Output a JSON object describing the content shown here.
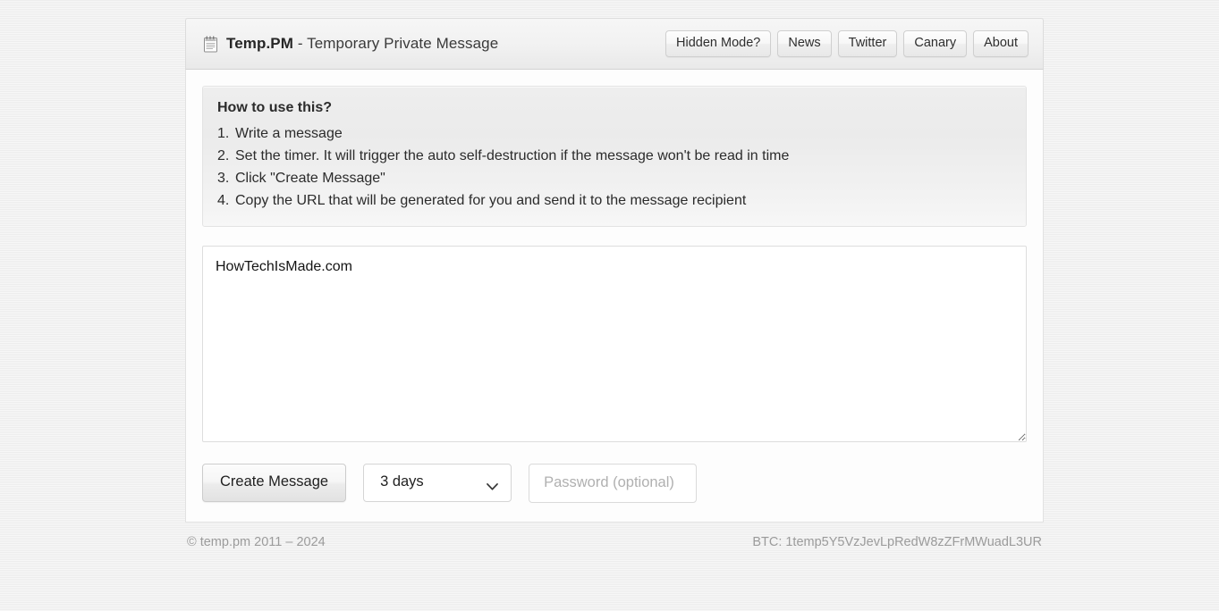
{
  "header": {
    "logo_icon": "notepad-icon",
    "brand_strong": "Temp.PM",
    "brand_sub": " - Temporary Private Message",
    "nav": [
      {
        "label": "Hidden Mode?"
      },
      {
        "label": "News"
      },
      {
        "label": "Twitter"
      },
      {
        "label": "Canary"
      },
      {
        "label": "About"
      }
    ]
  },
  "howto": {
    "title": "How to use this?",
    "steps": [
      {
        "num": "1.",
        "text": "Write a message"
      },
      {
        "num": "2.",
        "text": "Set the timer. It will trigger the auto self-destruction if the message won't be read in time"
      },
      {
        "num": "3.",
        "text": "Click \"Create Message\""
      },
      {
        "num": "4.",
        "text": "Copy the URL that will be generated for you and send it to the message recipient"
      }
    ]
  },
  "message": {
    "value": "HowTechIsMade.com",
    "placeholder": ""
  },
  "controls": {
    "create_label": "Create Message",
    "timer_selected": "3 days",
    "timer_options": [
      "3 days"
    ],
    "chevron_icon": "chevron-down-icon",
    "password_value": "",
    "password_placeholder": "Password (optional)"
  },
  "footer": {
    "copyright": "© temp.pm 2011 – 2024",
    "btc": "BTC: 1temp5Y5VzJevLpRedW8zZFrMWuadL3UR"
  },
  "colors": {
    "page_bg": "#f0f0f0",
    "panel_bg": "#fdfdfd",
    "header_bg": "#f1f1f1",
    "text": "#2b2b2b",
    "muted": "#9b9b9b"
  }
}
